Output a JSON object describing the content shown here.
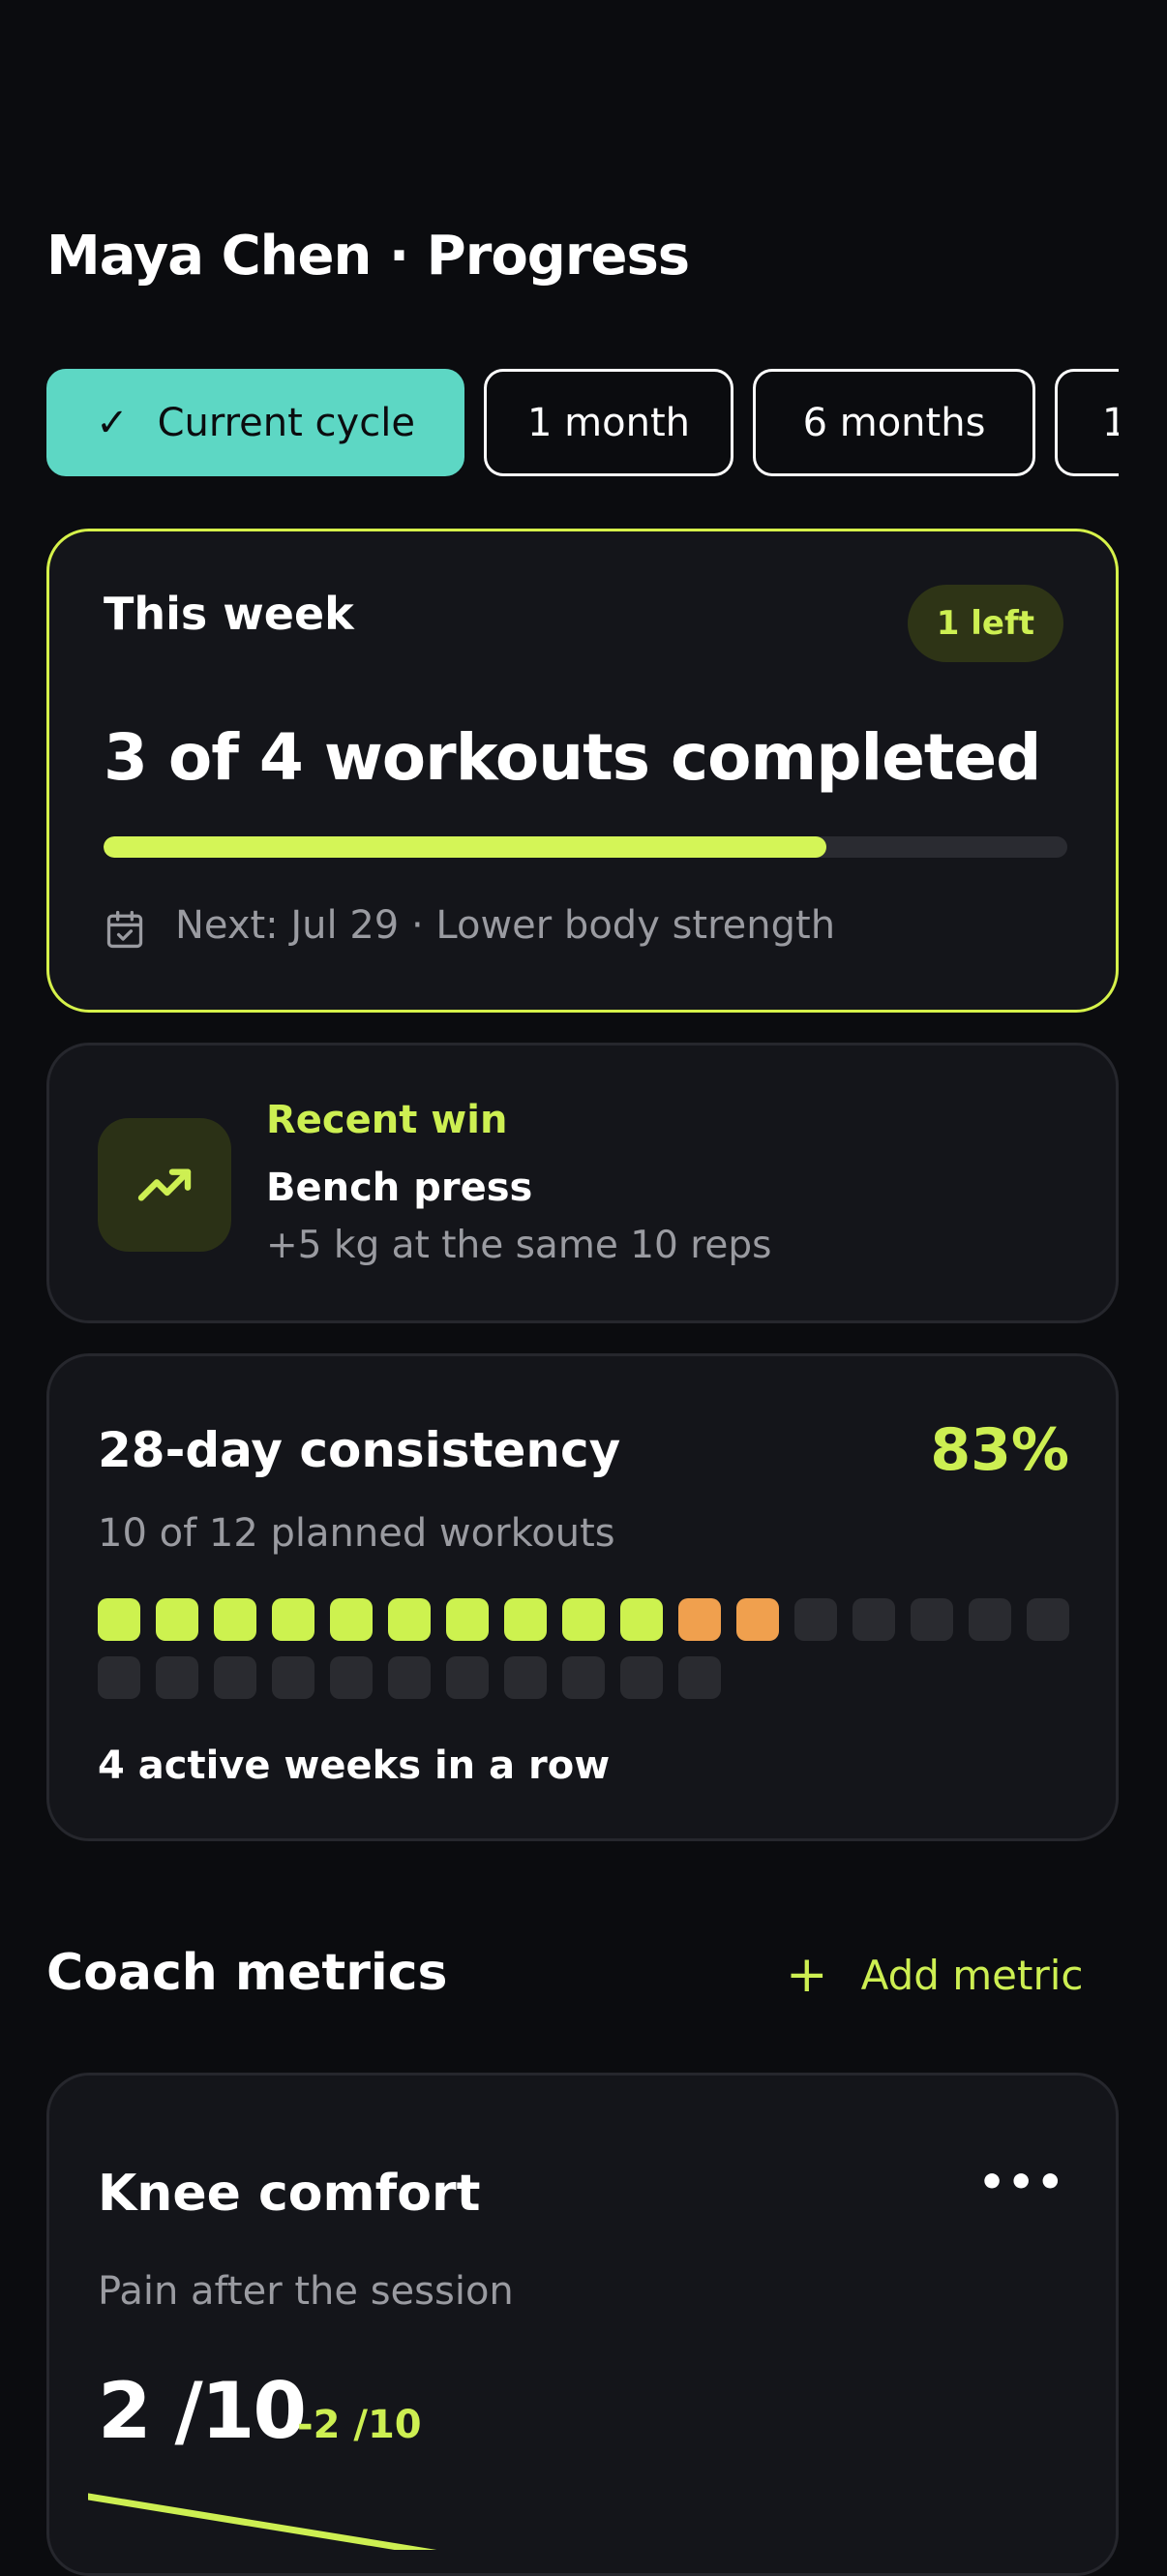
{
  "header": {
    "title": "Maya Chen · Progress"
  },
  "filters": [
    {
      "label": "Current cycle",
      "active": true
    },
    {
      "label": "1 month",
      "active": false
    },
    {
      "label": "6 months",
      "active": false
    },
    {
      "label": "1",
      "active": false
    }
  ],
  "week_card": {
    "title": "This week",
    "badge": "1 left",
    "headline": "3 of 4 workouts completed",
    "progress_fraction": 0.75,
    "next": "Next: Jul 29 · Lower body strength",
    "icon": "calendar-check-icon"
  },
  "win_card": {
    "label": "Recent win",
    "title": "Bench press",
    "subtitle": "+5 kg at the same 10 reps",
    "icon": "trending-up-icon"
  },
  "consistency_card": {
    "title": "28-day consistency",
    "percent": "83%",
    "subtitle": "10 of 12 planned workouts",
    "days": [
      "done",
      "done",
      "done",
      "done",
      "done",
      "done",
      "done",
      "done",
      "done",
      "done",
      "missed",
      "missed",
      "none",
      "none",
      "none",
      "none",
      "none",
      "none",
      "none",
      "none",
      "none",
      "none",
      "none",
      "none",
      "none",
      "none",
      "none",
      "none"
    ],
    "streak": "4 active weeks in a row",
    "colors": {
      "done": "#cdf24f",
      "missed": "#f0a04e",
      "none": "#2a2b30"
    }
  },
  "coach_metrics": {
    "title": "Coach metrics",
    "add_label": "Add metric"
  },
  "knee_card": {
    "title": "Knee comfort",
    "more_icon": "more-horizontal-icon",
    "subtitle": "Pain after the session",
    "value": "2 /10",
    "delta": "-2 /10"
  },
  "colors": {
    "accent": "#cdef52",
    "teal": "#5dd7c4",
    "background": "#0b0c0f",
    "card": "#14151a"
  }
}
